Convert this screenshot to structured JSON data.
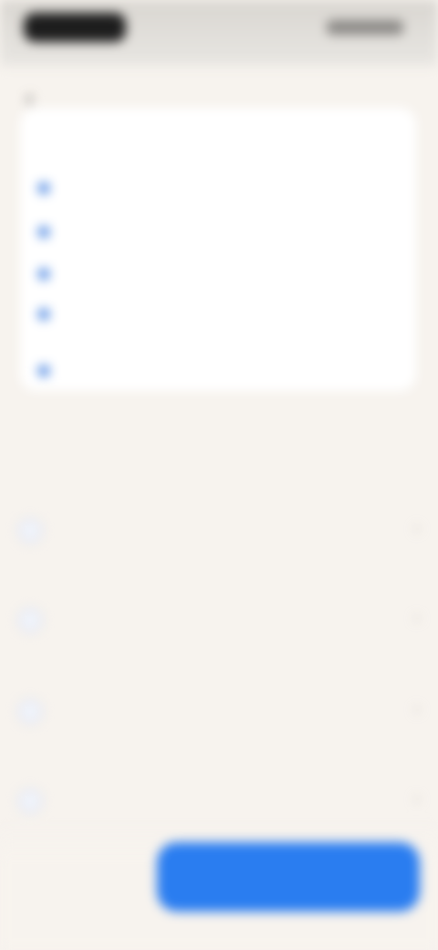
{
  "status_bar": {
    "time": "",
    "right": ""
  },
  "header": {
    "back_icon": "back-arrow-icon",
    "back_symbol": "‹"
  },
  "requirements_card": {
    "title": "",
    "items": [
      "",
      "",
      "",
      "",
      ""
    ]
  },
  "questions": {
    "title": "",
    "items": [
      "",
      "",
      "",
      ""
    ]
  },
  "footer": {
    "secondary_label": "",
    "primary_label": ""
  },
  "colors": {
    "background": "#f7f3ee",
    "card": "#ffffff",
    "accent": "#2a7df0",
    "bullet": "#3a7be0"
  }
}
